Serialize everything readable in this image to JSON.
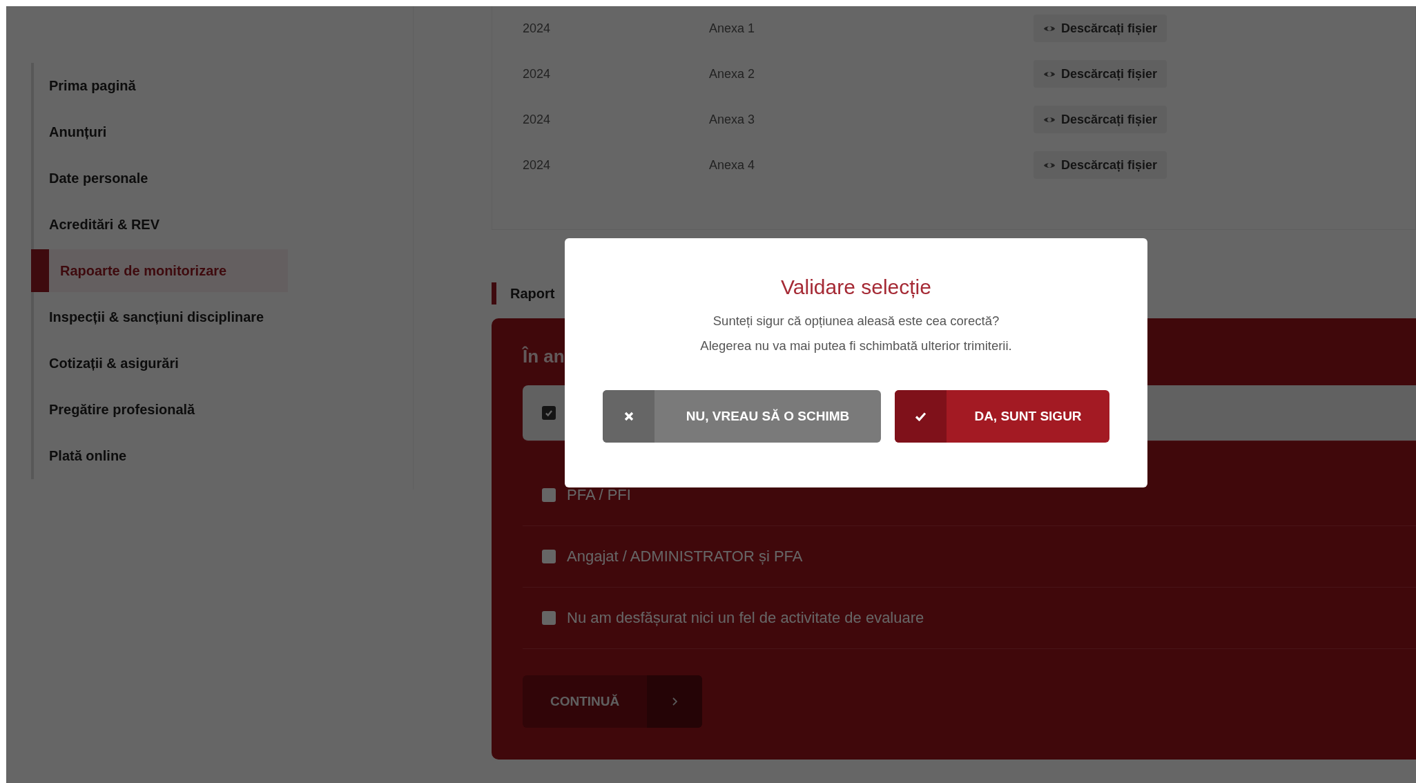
{
  "sidebar": {
    "items": [
      {
        "label": "Prima pagină",
        "selected": false
      },
      {
        "label": "Anunțuri",
        "selected": false
      },
      {
        "label": "Date personale",
        "selected": false
      },
      {
        "label": "Acreditări & REV",
        "selected": false
      },
      {
        "label": "Rapoarte de monitorizare",
        "selected": true
      },
      {
        "label": "Inspecții & sancțiuni disciplinare",
        "selected": false
      },
      {
        "label": "Cotizații & asigurări",
        "selected": false
      },
      {
        "label": "Pregătire profesională",
        "selected": false
      },
      {
        "label": "Plată online",
        "selected": false
      }
    ]
  },
  "files": {
    "rows": [
      {
        "year": "2024",
        "name": "Anexa 1",
        "action": "Descărcați fișier"
      },
      {
        "year": "2024",
        "name": "Anexa 2",
        "action": "Descărcați fișier"
      },
      {
        "year": "2024",
        "name": "Anexa 3",
        "action": "Descărcați fișier"
      },
      {
        "year": "2024",
        "name": "Anexa 4",
        "action": "Descărcați fișier"
      }
    ]
  },
  "section": {
    "heading": "Raport"
  },
  "form": {
    "question": "În an",
    "options": [
      {
        "checked": true
      },
      {
        "label": "PFA / PFI",
        "checked": false
      },
      {
        "label": "Angajat / ADMINISTRATOR și PFA",
        "checked": false
      },
      {
        "label": "Nu am desfășurat nici un fel de activitate de evaluare",
        "checked": false
      }
    ],
    "continue_button": {
      "label": "CONTINUĂ"
    }
  },
  "dialog": {
    "title": "Validare selecție",
    "message": [
      "Sunteți sigur că opțiunea aleasă este cea corectă?",
      "Alegerea nu va mai putea fi schimbată ulterior trimiterii."
    ],
    "buttons": [
      {
        "kind": "cancel",
        "label": "NU, VREAU SĂ O SCHIMB"
      },
      {
        "kind": "confirm",
        "label": "DA, SUNT SIGUR"
      }
    ]
  }
}
